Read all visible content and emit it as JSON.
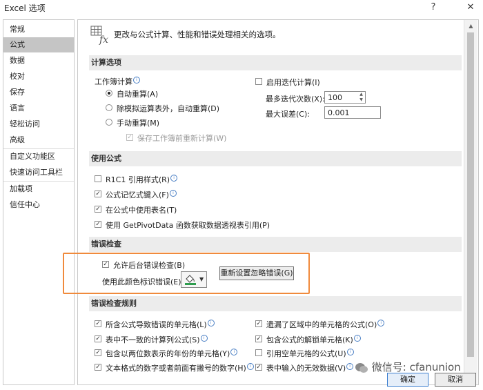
{
  "window": {
    "title": "Excel 选项",
    "help": "?",
    "close": "✕"
  },
  "sidebar": {
    "items": [
      {
        "label": "常规"
      },
      {
        "label": "公式"
      },
      {
        "label": "数据"
      },
      {
        "label": "校对"
      },
      {
        "label": "保存"
      },
      {
        "label": "语言"
      },
      {
        "label": "轻松访问"
      },
      {
        "label": "高级"
      },
      {
        "label": "自定义功能区"
      },
      {
        "label": "快速访问工具栏"
      },
      {
        "label": "加载项"
      },
      {
        "label": "信任中心"
      }
    ],
    "active": "公式"
  },
  "header": {
    "icon": "formula-fx-icon",
    "text": "更改与公式计算、性能和错误处理相关的选项。"
  },
  "calc": {
    "title": "计算选项",
    "workbook_label": "工作簿计算",
    "auto": "自动重算(A)",
    "auto_except": "除模拟运算表外，自动重算(D)",
    "manual": "手动重算(M)",
    "recalc_before_save": "保存工作簿前重新计算(W)",
    "iterative": "启用迭代计算(I)",
    "max_iter_label": "最多迭代次数(X):",
    "max_iter_value": "100",
    "max_change_label": "最大误差(C):",
    "max_change_value": "0.001"
  },
  "formulas": {
    "title": "使用公式",
    "r1c1": "R1C1 引用样式(R)",
    "autocomplete": "公式记忆式键入(F)",
    "table_names": "在公式中使用表名(T)",
    "getpivot": "使用 GetPivotData 函数获取数据透视表引用(P)"
  },
  "error_check": {
    "title": "错误检查",
    "enable_bg": "允许后台错误检查(B)",
    "color_label": "使用此颜色标识错误(E):",
    "color": "#2e9d4e",
    "reset_button": "重新设置忽略错误(G)"
  },
  "rules": {
    "title": "错误检查规则",
    "left": [
      "所含公式导致错误的单元格(L)",
      "表中不一致的计算列公式(S)",
      "包含以两位数表示的年份的单元格(Y)",
      "文本格式的数字或者前面有撇号的数字(H)"
    ],
    "right": [
      "遗漏了区域中的单元格的公式(O)",
      "包含公式的解锁单元格(K)",
      "引用空单元格的公式(U)",
      "表中输入的无效数据(V)"
    ]
  },
  "footer": {
    "ok": "确定",
    "cancel": "取消"
  },
  "watermark": "微信号: cfanunion"
}
